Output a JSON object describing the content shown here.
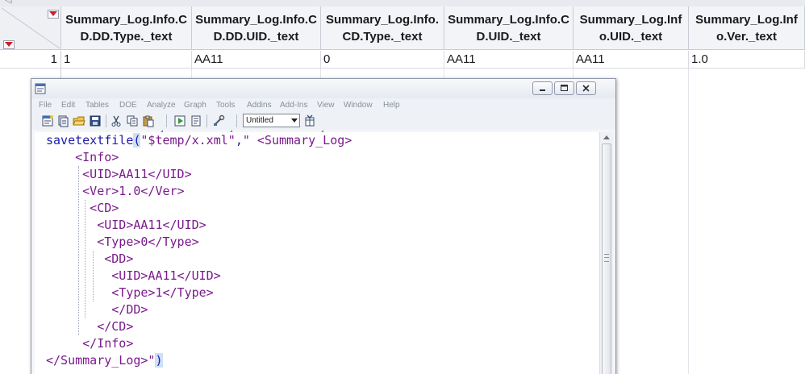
{
  "table": {
    "columns": [
      "Summary_Log.Info.CD.DD.Type._text",
      "Summary_Log.Info.CD.DD.UID._text",
      "Summary_Log.Info.CD.Type._text",
      "Summary_Log.Info.CD.UID._text",
      "Summary_Log.Info.UID._text",
      "Summary_Log.Info.Ver._text"
    ],
    "rows": [
      {
        "row_number": "1",
        "cells": [
          "1",
          "AA11",
          "0",
          "AA11",
          "AA11",
          "1.0"
        ]
      }
    ]
  },
  "script_window": {
    "menu": [
      "File",
      "Edit",
      "Tables",
      "DOE",
      "Analyze",
      "Graph",
      "Tools",
      "Addins",
      "Add-Ins",
      "View",
      "Window",
      "Help"
    ],
    "toolbar": {
      "buttons": [
        "new-script-icon",
        "open-icon",
        "open-folder-icon",
        "save-icon",
        "cut-icon",
        "copy-icon",
        "paste-icon",
        "run-script-icon",
        "properties-icon",
        "tools-icon",
        "table-select-icon"
      ],
      "table_select_value": "Untitled"
    },
    "code_lines": [
      {
        "fn": "savetextfile",
        "open": "(",
        "arg1": "\"$temp/x.xml\"",
        "comma": ",",
        "rest": "\" <Summary_Log>"
      },
      {
        "text": "    <Info>"
      },
      {
        "text": "     <UID>AA11</UID>"
      },
      {
        "text": "     <Ver>1.0</Ver>"
      },
      {
        "text": "      <CD>"
      },
      {
        "text": "       <UID>AA11</UID>"
      },
      {
        "text": "       <Type>0</Type>"
      },
      {
        "text": "        <DD>"
      },
      {
        "text": "         <UID>AA11</UID>"
      },
      {
        "text": "         <Type>1</Type>"
      },
      {
        "text": "         </DD>"
      },
      {
        "text": "       </CD>"
      },
      {
        "text": "     </Info>"
      },
      {
        "main": "</Summary_Log>\"",
        "close": ")"
      }
    ]
  }
}
